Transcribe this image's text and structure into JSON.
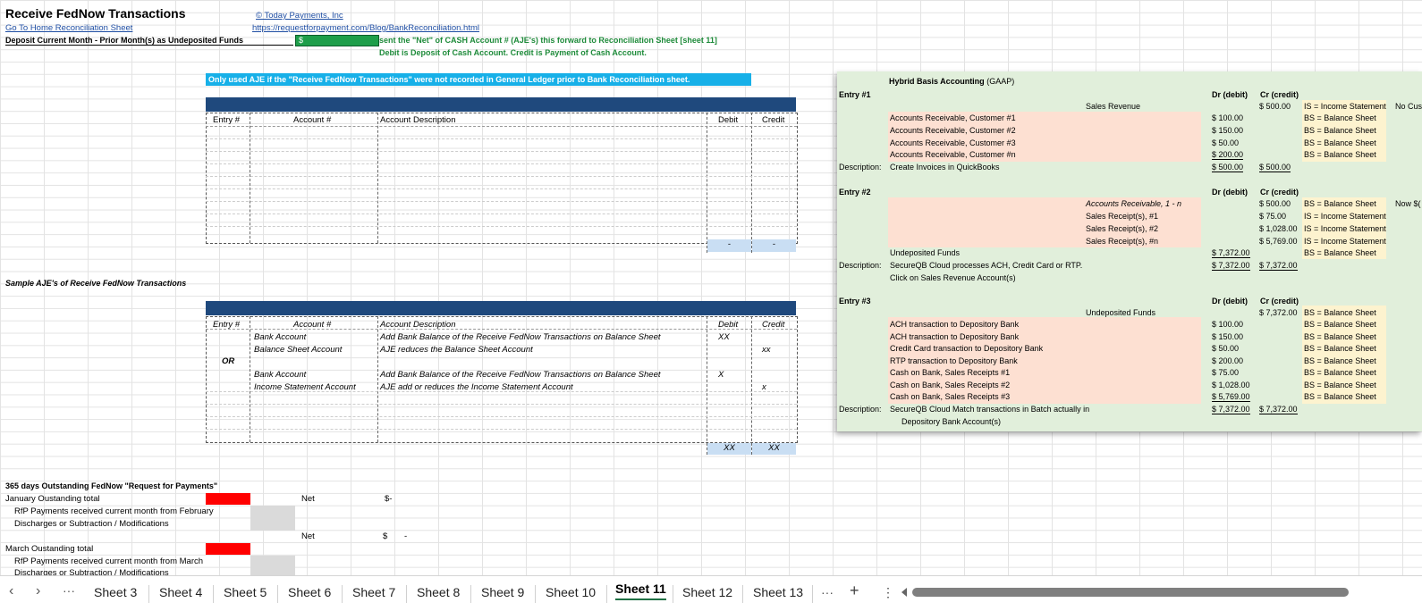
{
  "header": {
    "title": "Receive FedNow Transactions",
    "home_link": "Go To Home Reconciliation Sheet",
    "deposit_label": "Deposit Current Month - Prior Month(s) as Undeposited Funds",
    "copyright": "© Today Payments, Inc",
    "url": "https://requestforpayment.com/Blog/BankReconciliation.html",
    "deposit_cell": "$",
    "note1": "sent the \"Net\" of CASH Account # (AJE's) this forward to Reconciliation Sheet [sheet 11]",
    "note2": "Debit is Deposit of Cash Account.  Credit is Payment of Cash Account."
  },
  "banner": "Only used AJE if the \"Receive FedNow Transactions\" were not recorded in General Ledger prior to Bank Reconciliation sheet.",
  "table1": {
    "headers": [
      "Entry #",
      "Account #",
      "Account Description",
      "Debit",
      "Credit"
    ],
    "debit_total": "-",
    "credit_total": "-"
  },
  "sample_label": "Sample AJE's of Receive FedNow Transactions",
  "table2": {
    "headers": [
      "Entry #",
      "Account #",
      "Account Description",
      "Debit",
      "Credit"
    ],
    "rows": [
      {
        "account": "Bank Account",
        "desc": "Add Bank Balance of the Receive FedNow Transactions on Balance Sheet",
        "debit": "XX",
        "credit": ""
      },
      {
        "account": "Balance Sheet Account",
        "desc": "AJE reduces the Balance Sheet Account",
        "debit": "",
        "credit": "xx"
      },
      {
        "entry": "OR"
      },
      {
        "account": "Bank Account",
        "desc": "Add Bank Balance of the Receive FedNow Transactions on Balance Sheet",
        "debit": "X",
        "credit": ""
      },
      {
        "account": "Income Statement Account",
        "desc": "AJE add or reduces the Income Statement Account",
        "debit": "",
        "credit": "x"
      }
    ],
    "debit_total": "XX",
    "credit_total": "XX"
  },
  "outstanding": {
    "title": "365 days Outstanding FedNow \"Request for Payments\"",
    "jan_total": "January Oustanding total",
    "rfp_feb": "RfP Payments received current month from February",
    "disc1": "Discharges or Subtraction / Modifications",
    "net1": "Net",
    "net1_val": "$-",
    "net2": "Net",
    "net2_val": "$",
    "net2_dash": "-",
    "mar_total": "March Oustanding total",
    "rfp_mar": "RfP Payments received current month from March",
    "disc2": "Discharges or Subtraction / Modifications"
  },
  "panel": {
    "title": "Hybrid Basis Accounting",
    "title_suffix": "(GAAP)",
    "dr": "Dr (debit)",
    "cr": "Cr (credit)",
    "entry1": {
      "label": "Entry #1",
      "credit_account": "Sales Revenue",
      "credit_amount": "$   500.00",
      "credit_note": "IS = Income Statement",
      "extra": "No Cus",
      "lines": [
        {
          "acct": "Accounts Receivable, Customer #1",
          "dr": "$   100.00",
          "note": "BS = Balance Sheet"
        },
        {
          "acct": "Accounts Receivable, Customer #2",
          "dr": "$   150.00",
          "note": "BS = Balance Sheet"
        },
        {
          "acct": "Accounts Receivable, Customer #3",
          "dr": "$     50.00",
          "note": "BS = Balance Sheet"
        },
        {
          "acct": "Accounts Receivable, Customer #n",
          "dr": "$   200.00",
          "note": "BS = Balance Sheet"
        }
      ],
      "desc_label": "Description:",
      "desc": "Create Invoices in QuickBooks",
      "total_dr": "$   500.00",
      "total_cr": "$   500.00"
    },
    "entry2": {
      "label": "Entry #2",
      "extra": "Now $(",
      "credits": [
        {
          "acct": "Accounts Receivable, 1 - n",
          "cr": "$     500.00",
          "note": "BS = Balance Sheet"
        },
        {
          "acct": "Sales Receipt(s), #1",
          "cr": "$       75.00",
          "note": "IS = Income Statement"
        },
        {
          "acct": "Sales Receipt(s), #2",
          "cr": "$  1,028.00",
          "note": "IS = Income Statement"
        },
        {
          "acct": "Sales Receipt(s), #n",
          "cr": "$  5,769.00",
          "note": "IS = Income Statement"
        }
      ],
      "debit_acct": "Undeposited Funds",
      "debit_amount": "$ 7,372.00",
      "debit_note": "BS = Balance Sheet",
      "desc_label": "Description:",
      "desc": "SecureQB Cloud processes ACH, Credit Card or RTP.",
      "desc2": "Click on Sales Revenue Account(s)",
      "total_dr": "$ 7,372.00",
      "total_cr": "$ 7,372.00"
    },
    "entry3": {
      "label": "Entry #3",
      "credit_account": "Undeposited Funds",
      "credit_amount": "$ 7,372.00",
      "credit_note": "BS = Balance Sheet",
      "lines": [
        {
          "acct": "ACH transaction to Depository Bank",
          "dr": "$   100.00",
          "note": "BS = Balance Sheet"
        },
        {
          "acct": "ACH transaction to Depository Bank",
          "dr": "$   150.00",
          "note": "BS = Balance Sheet"
        },
        {
          "acct": "Credit Card transaction to Depository Bank",
          "dr": "$     50.00",
          "note": "BS = Balance Sheet"
        },
        {
          "acct": "RTP transaction to Depository Bank",
          "dr": "$   200.00",
          "note": "BS = Balance Sheet"
        },
        {
          "acct": "Cash on Bank, Sales Receipts #1",
          "dr": "$     75.00",
          "note": "BS = Balance Sheet"
        },
        {
          "acct": "Cash on Bank, Sales Receipts #2",
          "dr": "$ 1,028.00",
          "note": "BS = Balance Sheet"
        },
        {
          "acct": "Cash on Bank, Sales Receipts #3",
          "dr": "$ 5,769.00",
          "note": "BS = Balance Sheet"
        }
      ],
      "desc_label": "Description:",
      "desc": "SecureQB Cloud Match transactions in Batch actually in",
      "desc2": "Depository Bank Account(s)",
      "total_dr": "$ 7,372.00",
      "total_cr": "$ 7,372.00"
    }
  },
  "tabs": {
    "items": [
      "Sheet 3",
      "Sheet 4",
      "Sheet 5",
      "Sheet 6",
      "Sheet 7",
      "Sheet 8",
      "Sheet 9",
      "Sheet 10",
      "Sheet 11",
      "Sheet 12",
      "Sheet 13"
    ],
    "active": "Sheet 11",
    "prev": "‹",
    "next": "›",
    "more": "···",
    "add": "+",
    "menu": "⋮"
  }
}
